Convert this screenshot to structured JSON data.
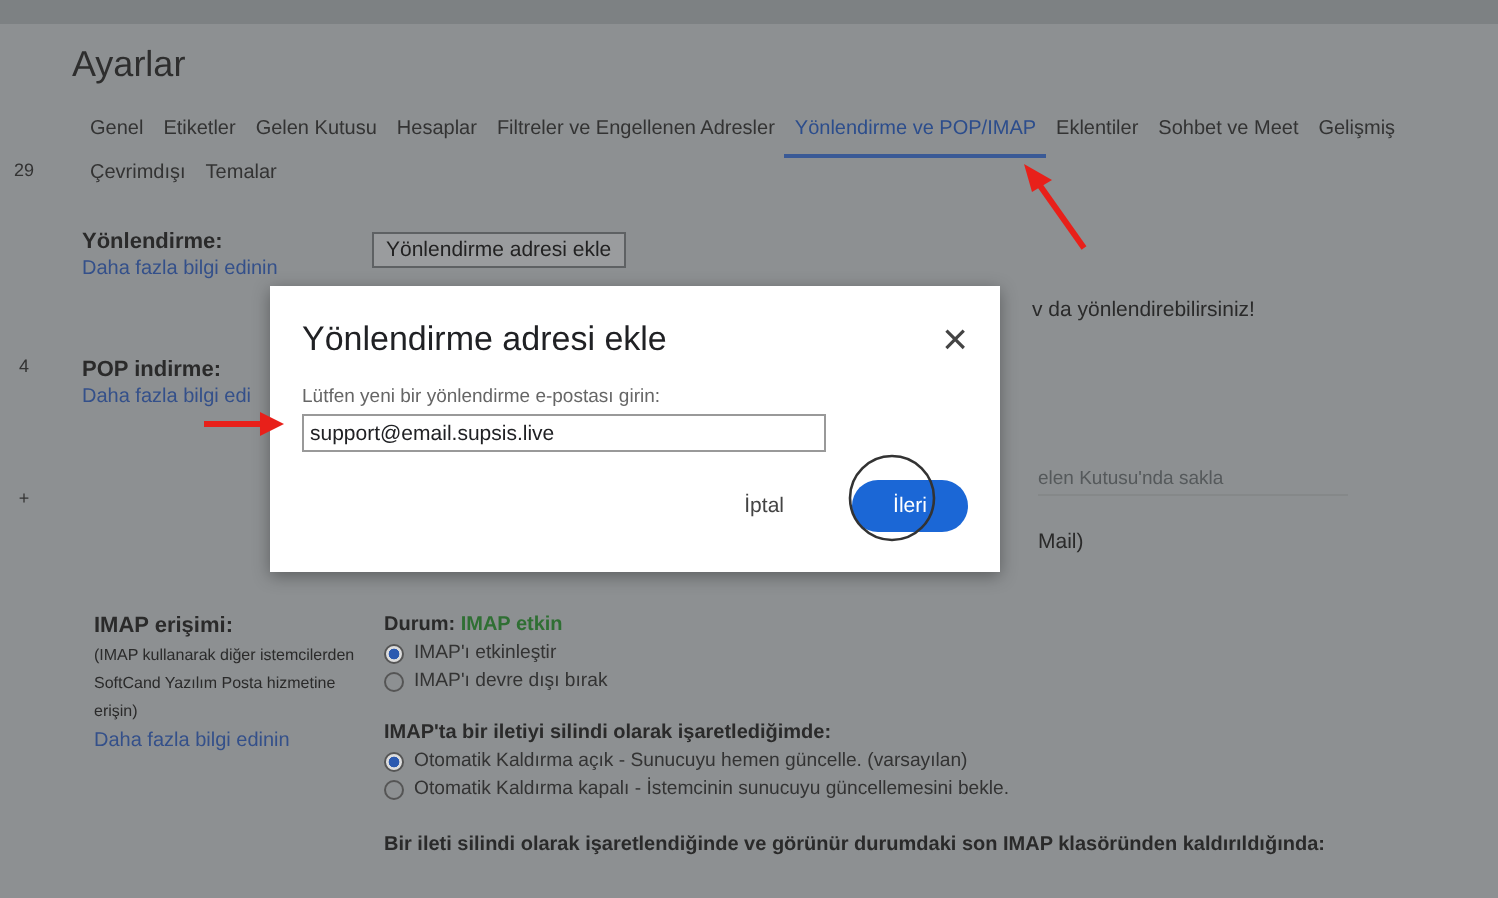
{
  "rail": [
    "29",
    "4",
    "+"
  ],
  "title": "Ayarlar",
  "tabs": [
    {
      "label": "Genel",
      "selected": false
    },
    {
      "label": "Etiketler",
      "selected": false
    },
    {
      "label": "Gelen Kutusu",
      "selected": false
    },
    {
      "label": "Hesaplar",
      "selected": false
    },
    {
      "label": "Filtreler ve Engellenen Adresler",
      "selected": false
    },
    {
      "label": "Yönlendirme ve POP/IMAP",
      "selected": true
    },
    {
      "label": "Eklentiler",
      "selected": false
    },
    {
      "label": "Sohbet ve Meet",
      "selected": false
    },
    {
      "label": "Gelişmiş",
      "selected": false
    },
    {
      "label": "Çevrimdışı",
      "selected": false
    },
    {
      "label": "Temalar",
      "selected": false
    }
  ],
  "forwarding": {
    "label": "Yönlendirme:",
    "link": "Daha fazla bilgi edinin",
    "button": "Yönlendirme adresi ekle",
    "note": "v da yönlendirebilirsiniz!"
  },
  "pop": {
    "label": "POP indirme:",
    "link": "Daha fazla bilgi edi",
    "dropdown": "elen Kutusu'nda sakla",
    "note": "Mail)"
  },
  "imap": {
    "label": "IMAP erişimi:",
    "description": "(IMAP kullanarak diğer istemcilerden SoftCand Yazılım Posta hizmetine erişin)",
    "link": "Daha fazla bilgi edinin",
    "status_label": "Durum:",
    "status": "IMAP etkin",
    "access_options": [
      {
        "label": "IMAP'ı etkinleştir",
        "selected": true
      },
      {
        "label": "IMAP'ı devre dışı bırak",
        "selected": false
      }
    ],
    "delete_heading": "IMAP'ta bir iletiyi silindi olarak işaretlediğimde:",
    "delete_options": [
      {
        "label": "Otomatik Kaldırma açık - Sunucuyu hemen güncelle. (varsayılan)",
        "selected": true
      },
      {
        "label": "Otomatik Kaldırma kapalı - İstemcinin sunucuyu güncellemesini bekle.",
        "selected": false
      }
    ],
    "expunge_heading": "Bir ileti silindi olarak işaretlendiğinde ve görünür durumdaki son IMAP klasöründen kaldırıldığında:"
  },
  "dialog": {
    "title": "Yönlendirme adresi ekle",
    "close": "×",
    "prompt": "Lütfen yeni bir yönlendirme e-postası girin:",
    "value": "support@email.supsis.live",
    "cancel": "İptal",
    "next": "İleri"
  }
}
